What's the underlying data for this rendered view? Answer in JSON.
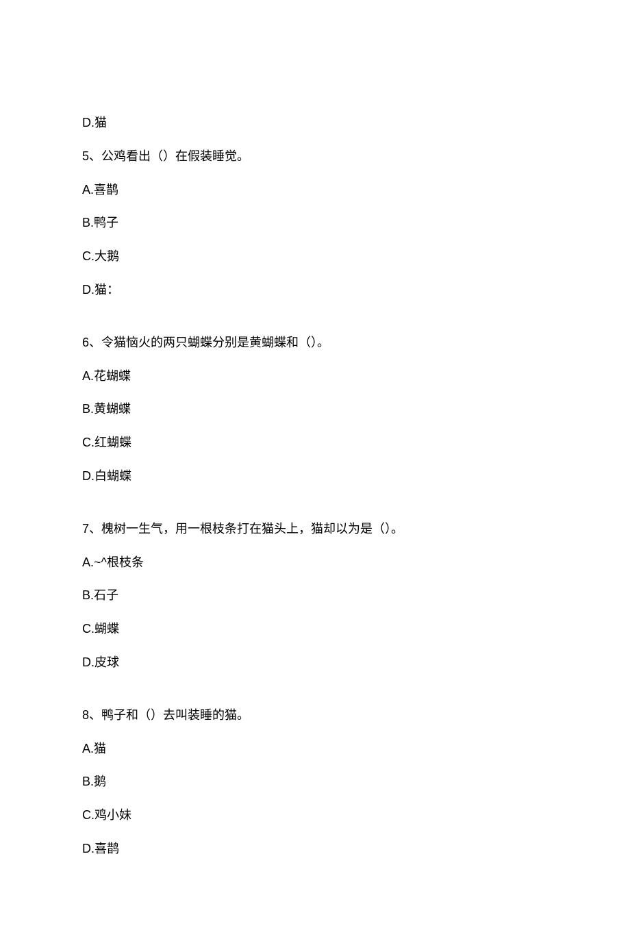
{
  "lines": [
    {
      "type": "opt",
      "latin": "D.",
      "cn": "猫"
    },
    {
      "type": "stem",
      "latin": "5",
      "cn": "、公鸡看出（）在假装睡觉。"
    },
    {
      "type": "opt",
      "latin": "A.",
      "cn": "喜鹊"
    },
    {
      "type": "opt",
      "latin": "B.",
      "cn": "鸭子"
    },
    {
      "type": "opt",
      "latin": "C.",
      "cn": "大鹅"
    },
    {
      "type": "opt",
      "latin": "D.",
      "cn": "猫："
    },
    {
      "type": "gap"
    },
    {
      "type": "stem",
      "latin": "6",
      "cn": "、令猫恼火的两只蝴蝶分别是黄蝴蝶和（）。"
    },
    {
      "type": "opt",
      "latin": "A.",
      "cn": "花蝴蝶"
    },
    {
      "type": "opt",
      "latin": "B.",
      "cn": "黄蝴蝶"
    },
    {
      "type": "opt",
      "latin": "C.",
      "cn": "红蝴蝶"
    },
    {
      "type": "opt",
      "latin": "D.",
      "cn": "白蝴蝶"
    },
    {
      "type": "gap"
    },
    {
      "type": "stem",
      "latin": "7",
      "cn": "、槐树一生气，用一根枝条打在猫头上，猫却以为是（）。"
    },
    {
      "type": "opt",
      "latin": "A.~^",
      "cn": "根枝条"
    },
    {
      "type": "opt",
      "latin": "B.",
      "cn": "石子"
    },
    {
      "type": "opt",
      "latin": "C.",
      "cn": "蝴蝶"
    },
    {
      "type": "opt",
      "latin": "D.",
      "cn": "皮球"
    },
    {
      "type": "gap"
    },
    {
      "type": "stem",
      "latin": "8",
      "cn": "、鸭子和（）去叫装睡的猫。"
    },
    {
      "type": "opt",
      "latin": "A.",
      "cn": "猫"
    },
    {
      "type": "opt",
      "latin": "B.",
      "cn": "鹅"
    },
    {
      "type": "opt",
      "latin": "C.",
      "cn": "鸡小妹"
    },
    {
      "type": "opt",
      "latin": "D.",
      "cn": "喜鹊"
    }
  ]
}
